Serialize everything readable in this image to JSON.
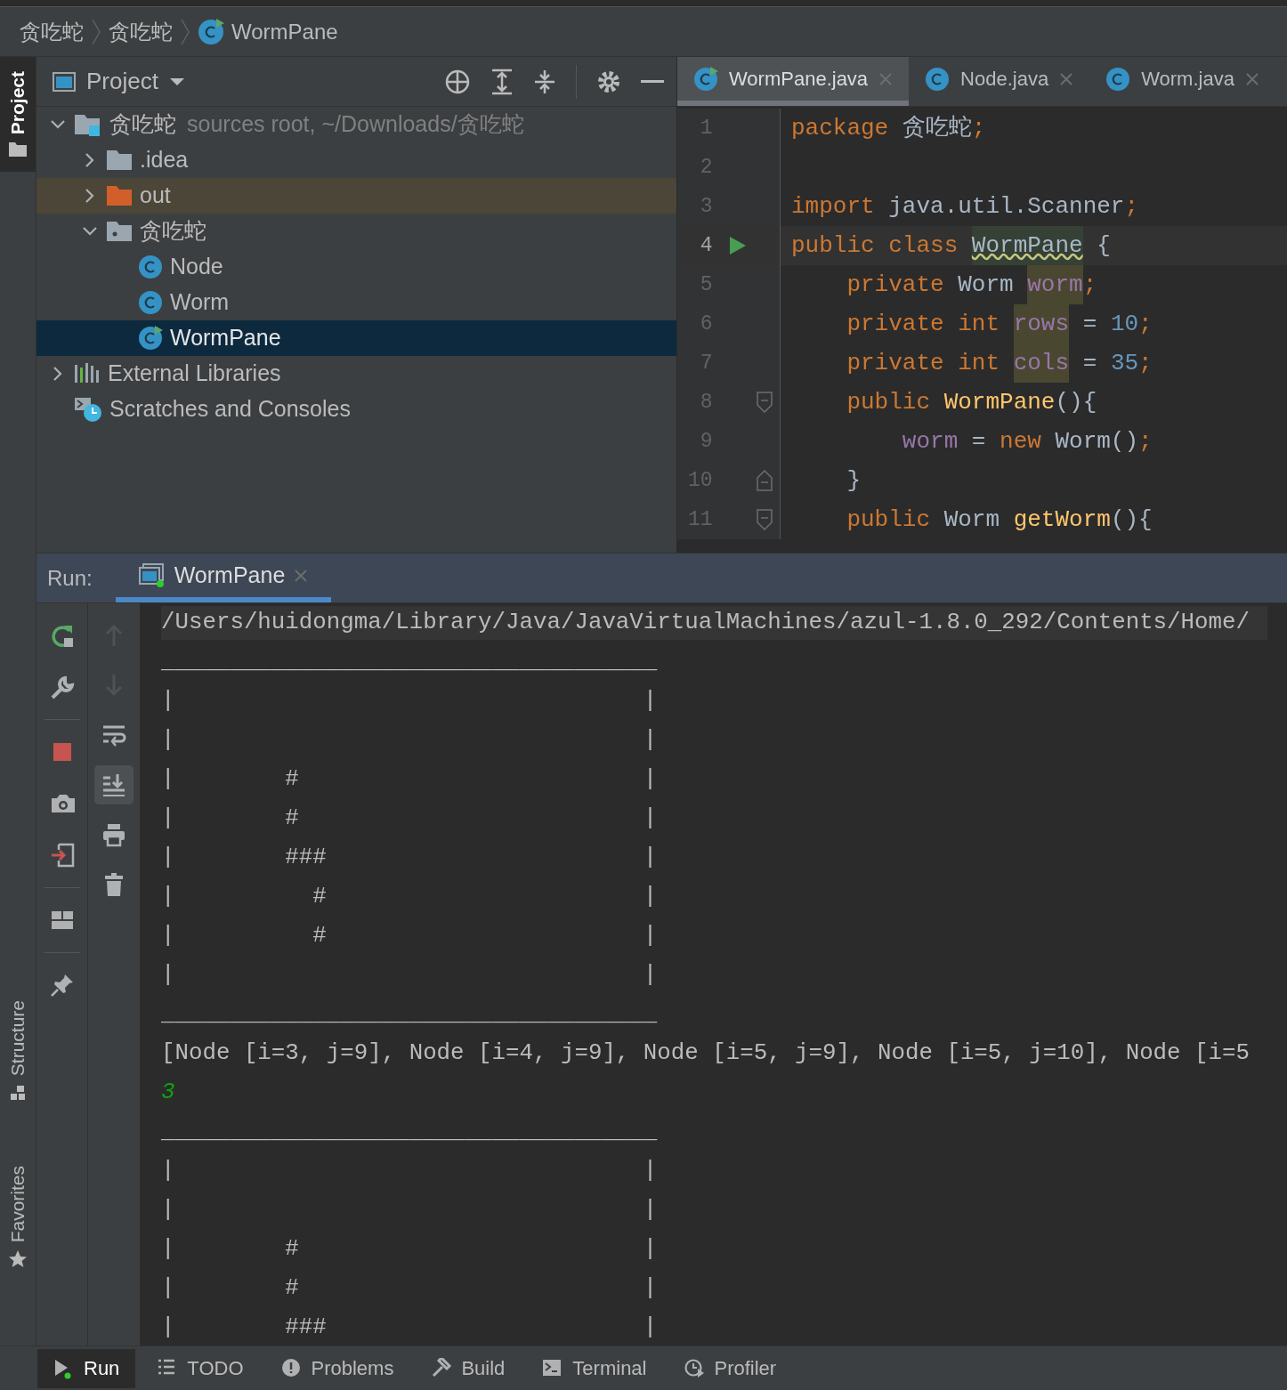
{
  "breadcrumbs": [
    {
      "label": "贪吃蛇",
      "kind": "package"
    },
    {
      "label": "贪吃蛇",
      "kind": "package"
    },
    {
      "label": "WormPane",
      "kind": "runnable-class"
    }
  ],
  "left_stripe": [
    {
      "label": "Project",
      "selected": true,
      "kind": "project"
    },
    {
      "label": "Structure",
      "selected": false,
      "kind": "structure"
    },
    {
      "label": "Favorites",
      "selected": false,
      "kind": "favorites"
    }
  ],
  "project_panel": {
    "title": "Project",
    "tree": [
      {
        "label": "贪吃蛇",
        "detail": "sources root, ~/Downloads/贪吃蛇",
        "kind": "module",
        "expanded": true,
        "selected": false,
        "children": [
          {
            "label": ".idea",
            "kind": "folder",
            "expanded": false,
            "selected": false
          },
          {
            "label": "out",
            "kind": "excluded-folder",
            "expanded": false,
            "selected": false
          },
          {
            "label": "贪吃蛇",
            "kind": "package",
            "expanded": true,
            "selected": false,
            "children": [
              {
                "label": "Node",
                "kind": "class",
                "selected": false
              },
              {
                "label": "Worm",
                "kind": "class",
                "selected": false
              },
              {
                "label": "WormPane",
                "kind": "runnable-class",
                "selected": true
              }
            ]
          }
        ]
      },
      {
        "label": "External Libraries",
        "kind": "libraries",
        "expanded": false,
        "selected": false
      },
      {
        "label": "Scratches and Consoles",
        "kind": "scratches",
        "selected": false
      }
    ]
  },
  "editor_tabs": [
    {
      "label": "WormPane.java",
      "kind": "runnable-class",
      "selected": true
    },
    {
      "label": "Node.java",
      "kind": "class",
      "selected": false
    },
    {
      "label": "Worm.java",
      "kind": "class",
      "selected": false
    }
  ],
  "code_lines": [
    {
      "number": "1",
      "tokens": [
        {
          "text": "package",
          "kind": "keyword"
        },
        {
          "text": " 贪吃蛇",
          "kind": "plain"
        },
        {
          "text": ";",
          "kind": "keyword"
        }
      ]
    },
    {
      "number": "2"
    },
    {
      "number": "3",
      "tokens": [
        {
          "text": "import",
          "kind": "keyword"
        },
        {
          "text": " java.util.Scanner",
          "kind": "plain"
        },
        {
          "text": ";",
          "kind": "keyword"
        }
      ]
    },
    {
      "number": "4",
      "current": true,
      "kind": "run-line",
      "tokens": [
        {
          "text": "public class ",
          "kind": "keyword"
        },
        {
          "text": "WormPane",
          "kind": "plain",
          "warning": true
        },
        {
          "text": " {",
          "kind": "plain"
        }
      ]
    },
    {
      "number": "5",
      "tokens": [
        {
          "text": "    private",
          "kind": "keyword"
        },
        {
          "text": " Worm ",
          "kind": "plain"
        },
        {
          "text": "worm",
          "kind": "field",
          "unused": true
        },
        {
          "text": ";",
          "kind": "keyword"
        }
      ]
    },
    {
      "number": "6",
      "tokens": [
        {
          "text": "    private int ",
          "kind": "keyword"
        },
        {
          "text": "rows",
          "kind": "field",
          "unused": true
        },
        {
          "text": " = ",
          "kind": "plain"
        },
        {
          "text": "10",
          "kind": "number"
        },
        {
          "text": ";",
          "kind": "keyword"
        }
      ]
    },
    {
      "number": "7",
      "tokens": [
        {
          "text": "    private int ",
          "kind": "keyword"
        },
        {
          "text": "cols",
          "kind": "field",
          "unused": true
        },
        {
          "text": " = ",
          "kind": "plain"
        },
        {
          "text": "35",
          "kind": "number"
        },
        {
          "text": ";",
          "kind": "keyword"
        }
      ]
    },
    {
      "number": "8",
      "kind": "fold-start",
      "tokens": [
        {
          "text": "    public ",
          "kind": "keyword"
        },
        {
          "text": "WormPane",
          "kind": "method"
        },
        {
          "text": "(){",
          "kind": "plain"
        }
      ]
    },
    {
      "number": "9",
      "tokens": [
        {
          "text": "        worm",
          "kind": "field"
        },
        {
          "text": " = ",
          "kind": "plain"
        },
        {
          "text": "new",
          "kind": "keyword"
        },
        {
          "text": " Worm()",
          "kind": "plain"
        },
        {
          "text": ";",
          "kind": "keyword"
        }
      ]
    },
    {
      "number": "10",
      "kind": "fold-end",
      "tokens": [
        {
          "text": "    }",
          "kind": "plain"
        }
      ]
    },
    {
      "number": "11",
      "kind": "fold-start",
      "tokens": [
        {
          "text": "    public",
          "kind": "keyword"
        },
        {
          "text": " Worm ",
          "kind": "plain"
        },
        {
          "text": "getWorm",
          "kind": "method"
        },
        {
          "text": "(){",
          "kind": "plain"
        }
      ]
    }
  ],
  "run_panel": {
    "label": "Run:",
    "tabs": [
      {
        "label": "WormPane",
        "selected": true
      }
    ],
    "toolbar": [
      {
        "kind": "rerun",
        "disabled": false
      },
      {
        "kind": "wrench",
        "disabled": false
      },
      {
        "kind": "divider"
      },
      {
        "kind": "stop",
        "disabled": false
      },
      {
        "kind": "camera",
        "disabled": false
      },
      {
        "kind": "exit",
        "disabled": false
      },
      {
        "kind": "divider"
      },
      {
        "kind": "layout",
        "disabled": false
      },
      {
        "kind": "divider"
      },
      {
        "kind": "pin",
        "disabled": false
      }
    ],
    "console_toolbar": [
      {
        "kind": "up",
        "disabled": true
      },
      {
        "kind": "down",
        "disabled": true
      },
      {
        "kind": "wrap",
        "disabled": false,
        "selected": false
      },
      {
        "kind": "scroll-end",
        "disabled": false,
        "selected": true
      },
      {
        "kind": "print",
        "disabled": false
      },
      {
        "kind": "trash",
        "disabled": false
      }
    ],
    "console_lines": [
      {
        "text": "/Users/huidongma/Library/Java/JavaVirtualMachines/azul-1.8.0_292/Contents/Home/",
        "kind": "command"
      },
      {
        "text": "____________________________________",
        "kind": "output"
      },
      {
        "text": "|                                  |",
        "kind": "output"
      },
      {
        "text": "|                                  |",
        "kind": "output"
      },
      {
        "text": "|        #                         |",
        "kind": "output"
      },
      {
        "text": "|        #                         |",
        "kind": "output"
      },
      {
        "text": "|        ###                       |",
        "kind": "output"
      },
      {
        "text": "|          #                       |",
        "kind": "output"
      },
      {
        "text": "|          #                       |",
        "kind": "output"
      },
      {
        "text": "|                                  |",
        "kind": "output"
      },
      {
        "text": "____________________________________",
        "kind": "output"
      },
      {
        "text": "[Node [i=3, j=9], Node [i=4, j=9], Node [i=5, j=9], Node [i=5, j=10], Node [i=5",
        "kind": "output"
      },
      {
        "text": "3",
        "kind": "input"
      },
      {
        "text": "____________________________________",
        "kind": "output"
      },
      {
        "text": "|                                  |",
        "kind": "output"
      },
      {
        "text": "|                                  |",
        "kind": "output"
      },
      {
        "text": "|        #                         |",
        "kind": "output"
      },
      {
        "text": "|        #                         |",
        "kind": "output"
      },
      {
        "text": "|        ###                       |",
        "kind": "output"
      }
    ]
  },
  "bottom_bar": [
    {
      "label": "Run",
      "kind": "run",
      "selected": true
    },
    {
      "label": "TODO",
      "kind": "todo",
      "selected": false
    },
    {
      "label": "Problems",
      "kind": "problems",
      "selected": false
    },
    {
      "label": "Build",
      "kind": "build",
      "selected": false
    },
    {
      "label": "Terminal",
      "kind": "terminal",
      "selected": false
    },
    {
      "label": "Profiler",
      "kind": "profiler",
      "selected": false
    }
  ]
}
